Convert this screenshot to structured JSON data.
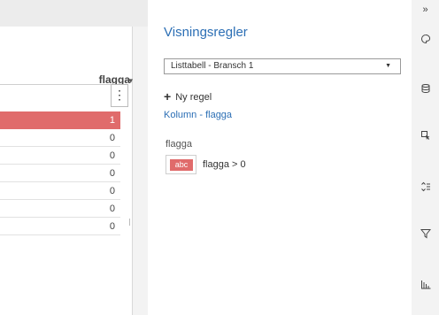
{
  "table": {
    "column_header": "flagga",
    "rows": [
      "1",
      "0",
      "0",
      "0",
      "0",
      "0",
      "0"
    ]
  },
  "rules_panel": {
    "title": "Visningsregler",
    "dropdown_value": "Listtabell - Bransch 1",
    "new_rule_label": "Ny regel",
    "column_link": "Kolumn - flagga",
    "field_label": "flagga",
    "rule_chip_text": "abc",
    "rule_condition": "flagga > 0"
  },
  "toolbar": {
    "collapse": "»"
  },
  "colors": {
    "highlight": "#e06b6b",
    "accent": "#2c6fb5"
  },
  "icons": [
    "collapse-icon",
    "palette-icon",
    "data-icon",
    "pointer-icon",
    "sort-icon",
    "filter-icon",
    "chart-icon"
  ]
}
